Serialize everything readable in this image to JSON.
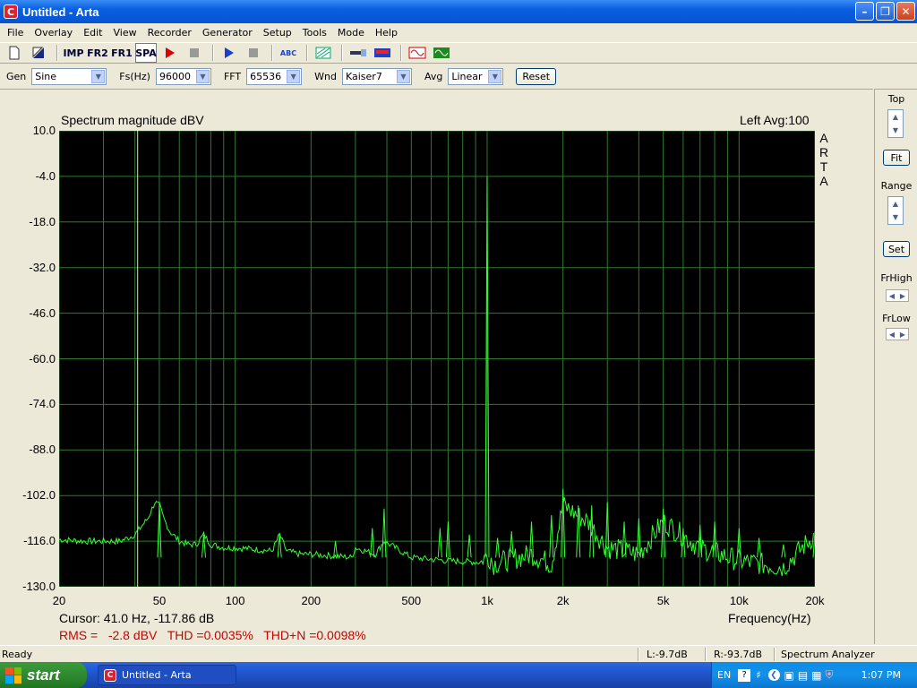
{
  "window": {
    "title": "Untitled - Arta",
    "icon_letter": "C"
  },
  "menu": [
    "File",
    "Overlay",
    "Edit",
    "View",
    "Recorder",
    "Generator",
    "Setup",
    "Tools",
    "Mode",
    "Help"
  ],
  "toolbar": {
    "imp": "IMP",
    "fr2": "FR2",
    "fr1": "FR1",
    "spa": "SPA",
    "abc": "ABC"
  },
  "controls": {
    "gen_label": "Gen",
    "gen_value": "Sine",
    "fs_label": "Fs(Hz)",
    "fs_value": "96000",
    "fft_label": "FFT",
    "fft_value": "65536",
    "wnd_label": "Wnd",
    "wnd_value": "Kaiser7",
    "avg_label": "Avg",
    "avg_value": "Linear",
    "reset_label": "Reset"
  },
  "plot": {
    "title": "Spectrum magnitude dBV",
    "channel": "Left  Avg:100",
    "logo": [
      "A",
      "R",
      "T",
      "A"
    ],
    "cursor": "Cursor:    41.0 Hz, -117.86 dB",
    "xlabel": "Frequency(Hz)",
    "measurements": "RMS =   -2.8 dBV   THD =0.0035%   THD+N =0.0098%"
  },
  "chart_data": {
    "type": "line",
    "title": "Spectrum magnitude dBV",
    "xlabel": "Frequency(Hz)",
    "ylabel": "",
    "x_scale": "log",
    "xlim": [
      20,
      20000
    ],
    "ylim": [
      -130,
      10
    ],
    "yticks": [
      "10.0",
      "-4.0",
      "-18.0",
      "-32.0",
      "-46.0",
      "-60.0",
      "-74.0",
      "-88.0",
      "-102.0",
      "-116.0",
      "-130.0"
    ],
    "xticks": [
      "20",
      "50",
      "100",
      "200",
      "500",
      "1k",
      "2k",
      "5k",
      "10k",
      "20k"
    ],
    "grid": true,
    "colors": {
      "background": "#000000",
      "grid": "#2f7a2f",
      "trace": "#33ff33",
      "cursor": "#c8ff66"
    },
    "cursor_x": 41,
    "series": [
      {
        "x": [
          20,
          25,
          30,
          35,
          40,
          45,
          48,
          50,
          52,
          55,
          60,
          65,
          70,
          75,
          80,
          90,
          100,
          120,
          140,
          150,
          160,
          180,
          200,
          240,
          290,
          300,
          360,
          390,
          500,
          700,
          950,
          1000,
          1050,
          1500,
          1800,
          2000,
          2500,
          3000,
          4000,
          5000,
          7000,
          10000,
          15000,
          20000
        ],
        "y": [
          -115.5,
          -116,
          -116,
          -116,
          -114,
          -109,
          -104,
          -105,
          -109,
          -113,
          -116,
          -117,
          -117,
          -114,
          -117,
          -118,
          -118,
          -118.5,
          -119,
          -114,
          -119,
          -120,
          -120,
          -120.5,
          -121,
          -118,
          -120,
          -116,
          -121,
          -122,
          -122.5,
          -4,
          -123,
          -120,
          -123,
          -105,
          -110,
          -118,
          -120,
          -110,
          -118,
          -122,
          -124,
          -114
        ]
      }
    ],
    "peaks": [
      {
        "x": 50,
        "y": -104
      },
      {
        "x": 75,
        "y": -114
      },
      {
        "x": 150,
        "y": -114
      },
      {
        "x": 250,
        "y": -116
      },
      {
        "x": 350,
        "y": -112
      },
      {
        "x": 390,
        "y": -106
      },
      {
        "x": 650,
        "y": -112
      },
      {
        "x": 700,
        "y": -110
      },
      {
        "x": 850,
        "y": -114
      },
      {
        "x": 1000,
        "y": -4
      },
      {
        "x": 1100,
        "y": -115
      },
      {
        "x": 1250,
        "y": -113
      },
      {
        "x": 1500,
        "y": -110
      },
      {
        "x": 1800,
        "y": -108
      },
      {
        "x": 2000,
        "y": -100
      },
      {
        "x": 2300,
        "y": -105
      },
      {
        "x": 2600,
        "y": -105
      },
      {
        "x": 3000,
        "y": -104
      },
      {
        "x": 3500,
        "y": -110
      },
      {
        "x": 4000,
        "y": -109
      },
      {
        "x": 5000,
        "y": -106
      },
      {
        "x": 6000,
        "y": -112
      },
      {
        "x": 7000,
        "y": -111
      },
      {
        "x": 8000,
        "y": -110
      },
      {
        "x": 10000,
        "y": -112
      },
      {
        "x": 12000,
        "y": -115
      },
      {
        "x": 15000,
        "y": -117
      },
      {
        "x": 20000,
        "y": -113
      }
    ]
  },
  "side": {
    "top": "Top",
    "fit": "Fit",
    "range": "Range",
    "set": "Set",
    "frhigh": "FrHigh",
    "frlow": "FrLow"
  },
  "status": {
    "ready": "Ready",
    "left": "L:-9.7dB",
    "right": "R:-93.7dB",
    "mode": "Spectrum Analyzer"
  },
  "taskbar": {
    "start": "start",
    "task": "Untitled - Arta",
    "lang": "EN",
    "clock": "1:07 PM"
  }
}
